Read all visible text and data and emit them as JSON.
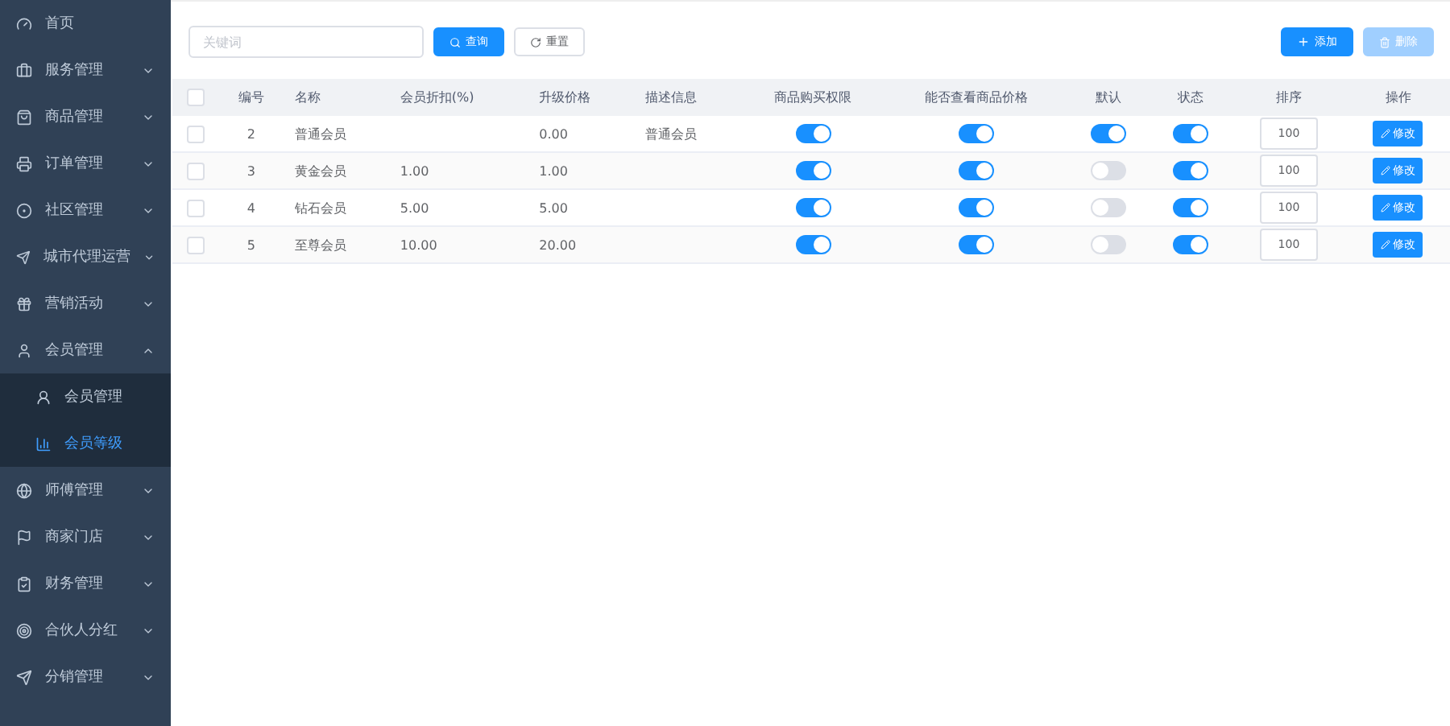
{
  "sidebar": {
    "items": [
      {
        "label": "首页",
        "expandable": false
      },
      {
        "label": "服务管理",
        "expandable": true,
        "expanded": false
      },
      {
        "label": "商品管理",
        "expandable": true,
        "expanded": false
      },
      {
        "label": "订单管理",
        "expandable": true,
        "expanded": false
      },
      {
        "label": "社区管理",
        "expandable": true,
        "expanded": false
      },
      {
        "label": "城市代理运营",
        "expandable": true,
        "expanded": false
      },
      {
        "label": "营销活动",
        "expandable": true,
        "expanded": false
      },
      {
        "label": "会员管理",
        "expandable": true,
        "expanded": true,
        "children": [
          {
            "label": "会员管理",
            "selected": false
          },
          {
            "label": "会员等级",
            "selected": true
          }
        ]
      },
      {
        "label": "师傅管理",
        "expandable": true,
        "expanded": false
      },
      {
        "label": "商家门店",
        "expandable": true,
        "expanded": false
      },
      {
        "label": "财务管理",
        "expandable": true,
        "expanded": false
      },
      {
        "label": "合伙人分红",
        "expandable": true,
        "expanded": false
      },
      {
        "label": "分销管理",
        "expandable": true,
        "expanded": false
      }
    ]
  },
  "toolbar": {
    "search": {
      "placeholder": "关键词"
    },
    "query_button": "查询",
    "reset_button": "重置",
    "add_button": "添加",
    "delete_button": {
      "label": "删除",
      "disabled": true
    }
  },
  "table": {
    "all_checked": false,
    "columns": [
      "编号",
      "名称",
      "会员折扣(%)",
      "升级价格",
      "描述信息",
      "商品购买权限",
      "能否查看商品价格",
      "默认",
      "状态",
      "排序",
      "操作"
    ],
    "rows": [
      {
        "checked": false,
        "id": "2",
        "name": "普通会员",
        "price": "0.00",
        "description": "普通会员",
        "buy": true,
        "view_price": true,
        "default": true,
        "status": true,
        "sort": "100",
        "action": "修改"
      },
      {
        "checked": false,
        "id": "3",
        "name": "黄金会员",
        "discount": "1.00",
        "price": "1.00",
        "buy": true,
        "view_price": true,
        "default": false,
        "status": true,
        "sort": "100",
        "action": "修改"
      },
      {
        "checked": false,
        "id": "4",
        "name": "钻石会员",
        "discount": "5.00",
        "price": "5.00",
        "buy": true,
        "view_price": true,
        "default": false,
        "status": true,
        "sort": "100",
        "action": "修改"
      },
      {
        "checked": false,
        "id": "5",
        "name": "至尊会员",
        "discount": "10.00",
        "price": "20.00",
        "buy": true,
        "view_price": true,
        "default": false,
        "status": true,
        "sort": "100",
        "action": "修改"
      }
    ]
  }
}
